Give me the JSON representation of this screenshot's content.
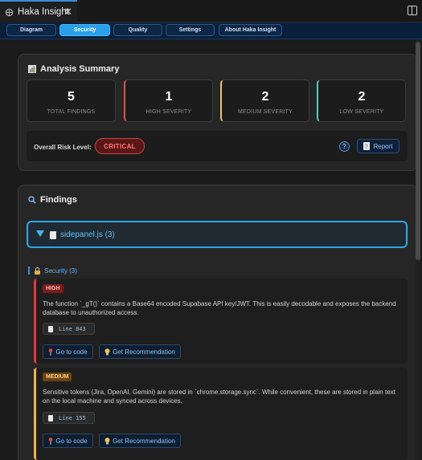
{
  "window": {
    "tab_title": "Haka Insight",
    "close_glyph": "✕"
  },
  "nav": {
    "tabs": [
      {
        "label": "Diagram"
      },
      {
        "label": "Security"
      },
      {
        "label": "Quality"
      },
      {
        "label": "Settings"
      },
      {
        "label": "About Haka Insight"
      }
    ],
    "active": "Security"
  },
  "summary": {
    "title": "Analysis Summary",
    "stats": [
      {
        "value": "5",
        "label": "TOTAL FINDINGS",
        "color": "#3b3b3b"
      },
      {
        "value": "1",
        "label": "HIGH SEVERITY",
        "color": "#d9534f"
      },
      {
        "value": "2",
        "label": "MEDIUM SEVERITY",
        "color": "#e7c36b"
      },
      {
        "value": "2",
        "label": "LOW SEVERITY",
        "color": "#4fd1b7"
      }
    ],
    "risk_label": "Overall Risk Level:",
    "risk_value": "CRITICAL",
    "help_glyph": "?",
    "report_label": "Report"
  },
  "findings": {
    "title": "Findings",
    "file_label": "sidepanel.js (3)",
    "category_label": "Security (3)",
    "items": [
      {
        "severity": "HIGH",
        "severity_color": "#b43838",
        "border_color": "#c84444",
        "text": "The function `_gT()` contains a Base64 encoded Supabase API key/JWT. This is easily decodable and exposes the backend database to unauthorized access.",
        "line": "Line 843",
        "goto_label": "Go to code",
        "recommend_label": "Get Recommendation"
      },
      {
        "severity": "MEDIUM",
        "severity_color": "#7a4f12",
        "border_color": "#e0b85a",
        "text": "Sensitive tokens (Jira, OpenAI, Gemini) are stored in `chrome.storage.sync`. While convenient, these are stored in plain text on the local machine and synced across devices.",
        "line": "Line 155",
        "goto_label": "Go to code",
        "recommend_label": "Get Recommendation"
      }
    ]
  }
}
